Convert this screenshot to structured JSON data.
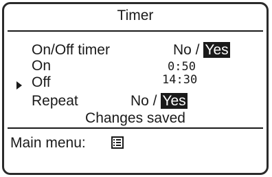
{
  "screen": {
    "title": "Timer",
    "rows": {
      "onoff_timer": {
        "label": "On/Off timer",
        "no": "No /",
        "yes": "Yes"
      },
      "on": {
        "label": "On",
        "time": "0:50"
      },
      "off": {
        "label": "Off",
        "time": "14:30"
      },
      "repeat": {
        "label": "Repeat",
        "no": "No /",
        "yes": "Yes"
      }
    },
    "status": "Changes saved",
    "main_menu_label": "Main menu:",
    "main_menu_icon": "menu-list-icon",
    "selected_row": "off"
  }
}
